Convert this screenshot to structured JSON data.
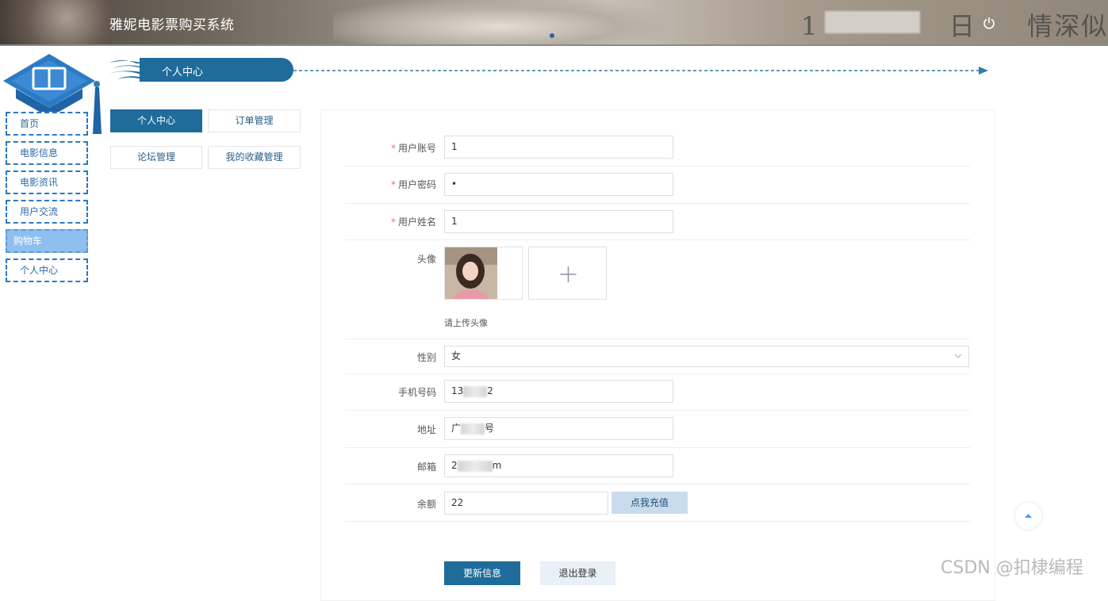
{
  "header": {
    "title": "雅妮电影票购买系统",
    "banner_left": "1",
    "banner_right": "日",
    "banner_tail": "情深似"
  },
  "sidebar": {
    "items": [
      {
        "label": "首页",
        "active": false
      },
      {
        "label": "电影信息",
        "active": false
      },
      {
        "label": "电影资讯",
        "active": false
      },
      {
        "label": "用户交流",
        "active": false
      },
      {
        "label": "购物车",
        "active": true
      },
      {
        "label": "个人中心",
        "active": false
      }
    ]
  },
  "page": {
    "title": "个人中心"
  },
  "subtabs": [
    {
      "label": "个人中心",
      "active": true
    },
    {
      "label": "订单管理",
      "active": false
    },
    {
      "label": "论坛管理",
      "active": false
    },
    {
      "label": "我的收藏管理",
      "active": false
    }
  ],
  "form": {
    "account": {
      "label": "用户账号",
      "value": "1",
      "required": true
    },
    "password": {
      "label": "用户密码",
      "value": "•",
      "required": true
    },
    "name": {
      "label": "用户姓名",
      "value": "1",
      "required": true
    },
    "avatar": {
      "label": "头像",
      "hint": "请上传头像",
      "upload_symbol": "+"
    },
    "gender": {
      "label": "性别",
      "value": "女"
    },
    "phone": {
      "label": "手机号码",
      "prefix": "13",
      "suffix": "2"
    },
    "address": {
      "label": "地址",
      "prefix": "广",
      "suffix": "号"
    },
    "email": {
      "label": "邮箱",
      "prefix": "2",
      "suffix": "m"
    },
    "balance": {
      "label": "余额",
      "value": "22"
    }
  },
  "buttons": {
    "recharge": "点我充值",
    "update": "更新信息",
    "logout": "退出登录"
  },
  "watermark": "CSDN @扣棣编程",
  "colors": {
    "accent": "#1f6c9a",
    "sidebar_border": "#2b78c6",
    "sidebar_active": "#8fbfef",
    "required": "#f56c6c"
  }
}
